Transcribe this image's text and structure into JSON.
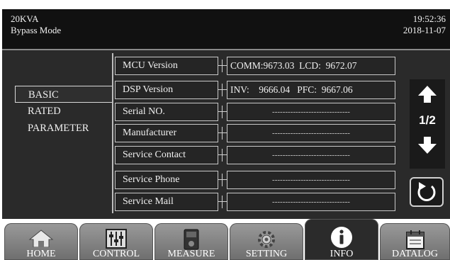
{
  "header": {
    "model": "20KVA",
    "mode": "Bypass Mode",
    "time": "19:52:36",
    "date": "2018-11-07"
  },
  "nav": {
    "items": [
      {
        "label": "BASIC",
        "active": true
      },
      {
        "label": "RATED",
        "active": false
      },
      {
        "label": "PARAMETER",
        "active": false
      }
    ]
  },
  "info_rows": [
    {
      "label": "MCU Version",
      "value": "COMM:9673.03  LCD:  9672.07"
    },
    {
      "label": "DSP Version",
      "value": "INV:    9666.04   PFC:  9667.06"
    },
    {
      "label": "Serial NO.",
      "value": "------------------------------"
    },
    {
      "label": "Manufacturer",
      "value": "------------------------------"
    },
    {
      "label": "Service Contact",
      "value": "------------------------------"
    },
    {
      "label": "Service Phone",
      "value": "------------------------------"
    },
    {
      "label": "Service Mail",
      "value": "------------------------------"
    }
  ],
  "pager": {
    "indicator": "1/2",
    "up_icon": "arrow-up-icon",
    "down_icon": "arrow-down-icon",
    "back_icon": "refresh-icon"
  },
  "tabs": [
    {
      "label": "HOME",
      "icon": "home-icon",
      "active": false
    },
    {
      "label": "CONTROL",
      "icon": "sliders-icon",
      "active": false
    },
    {
      "label": "MEASURE",
      "icon": "meter-icon",
      "active": false
    },
    {
      "label": "SETTING",
      "icon": "gear-icon",
      "active": false
    },
    {
      "label": "INFO",
      "icon": "info-icon",
      "active": true
    },
    {
      "label": "DATALOG",
      "icon": "calendar-icon",
      "active": false
    }
  ],
  "colors": {
    "header_bg": "#111111",
    "main_bg": "#2a2a2a",
    "tab_bg": "#8a8a8a",
    "tab_active_bg": "#2b2b2b"
  }
}
